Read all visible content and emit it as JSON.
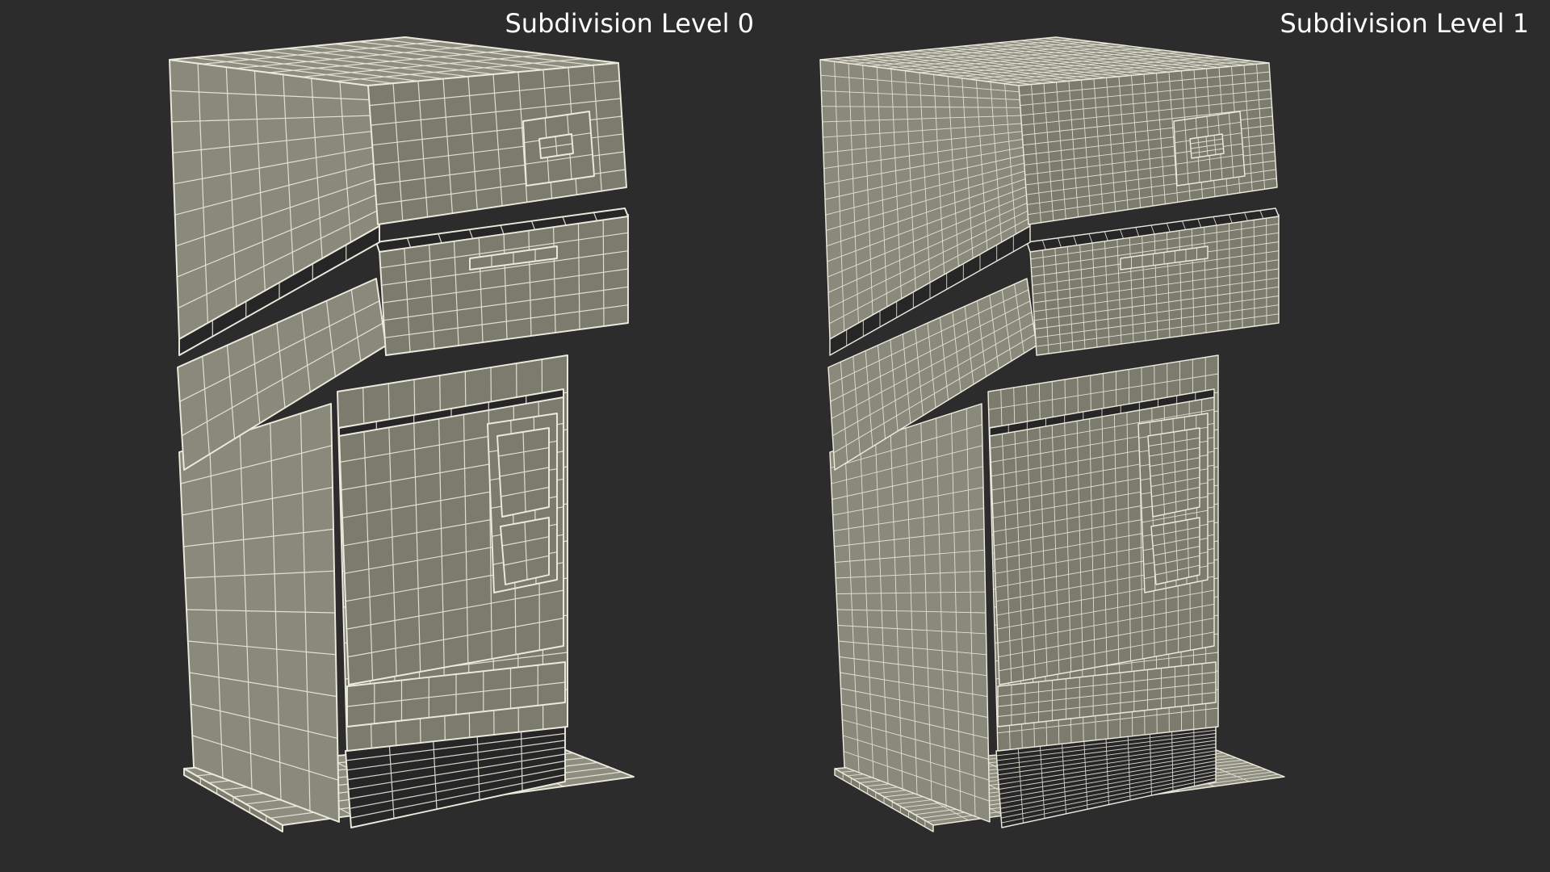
{
  "views": [
    {
      "label": "Subdivision Level 0",
      "density": 1
    },
    {
      "label": "Subdivision Level 1",
      "density": 2
    }
  ],
  "colors": {
    "background": "#2c2c2c",
    "face_side": "#8a8a7c",
    "face_front": "#7b7b6e",
    "face_top": "#8e8e80",
    "face_dark": "#262626",
    "wire": "#eceadd"
  }
}
